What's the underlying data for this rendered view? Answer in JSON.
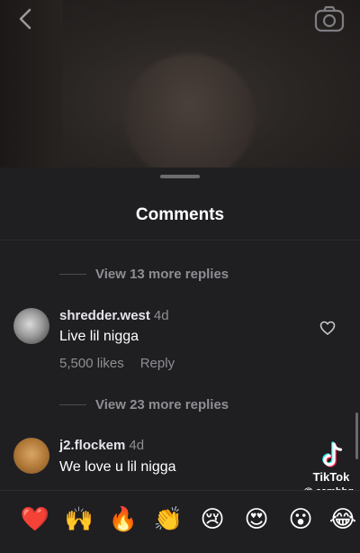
{
  "sheet": {
    "title": "Comments"
  },
  "comments": [
    {
      "view_replies": "View 13 more replies"
    },
    {
      "username": "shredder.west",
      "age": "4d",
      "text": "Live lil nigga",
      "likes": "5,500 likes",
      "reply_label": "Reply",
      "view_replies": "View 23 more replies"
    },
    {
      "username": "j2.flockem",
      "age": "4d",
      "text": "We love u lil nigga"
    }
  ],
  "watermark": {
    "brand": "TikTok",
    "handle": "@ cambbg"
  },
  "emoji_bar": {
    "emojis": [
      "❤️",
      "🙌",
      "🔥",
      "👏",
      "😢",
      "😍",
      "😮",
      "😂"
    ]
  },
  "icons": {
    "back": "chevron-left-icon",
    "camera": "camera-icon",
    "heart": "heart-outline-icon",
    "tiktok": "tiktok-note-icon"
  },
  "colors": {
    "sheet_background": "#1f1f22",
    "secondary_text": "#8e8e93",
    "primary_text": "#ffffff"
  }
}
